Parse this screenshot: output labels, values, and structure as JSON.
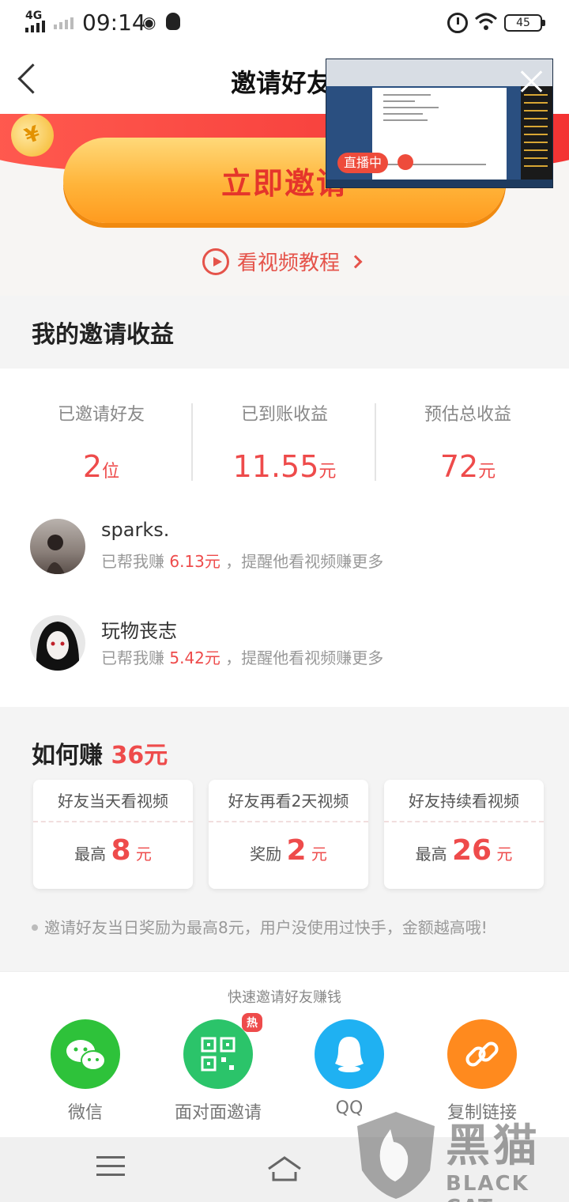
{
  "status_bar": {
    "network": "4G",
    "time": "09:14",
    "battery": "45"
  },
  "header": {
    "title": "邀请好友"
  },
  "banner": {
    "coin_symbol": "¥",
    "invite_button": "立即邀请",
    "video_link": "看视频教程"
  },
  "live_overlay": {
    "badge": "直播中"
  },
  "earnings": {
    "title": "我的邀请收益",
    "stats": [
      {
        "label": "已邀请好友",
        "value": "2",
        "unit": "位"
      },
      {
        "label": "已到账收益",
        "value": "11.55",
        "unit": "元"
      },
      {
        "label": "预估总收益",
        "value": "72",
        "unit": "元"
      }
    ],
    "friends": [
      {
        "name": "sparks.",
        "desc_prefix": "已帮我赚",
        "amount": "6.13元",
        "desc_suffix": "，提醒他看视频赚更多"
      },
      {
        "name": "玩物丧志",
        "desc_prefix": "已帮我赚",
        "amount": "5.42元",
        "desc_suffix": "，提醒他看视频赚更多"
      }
    ]
  },
  "how_to_earn": {
    "title_prefix": "如何赚",
    "title_amount": "36元",
    "tiers": [
      {
        "label": "好友当天看视频",
        "prefix": "最高",
        "amount": "8",
        "unit": "元"
      },
      {
        "label": "好友再看2天视频",
        "prefix": "奖励",
        "amount": "2",
        "unit": "元"
      },
      {
        "label": "好友持续看视频",
        "prefix": "最高",
        "amount": "26",
        "unit": "元"
      }
    ],
    "note": "邀请好友当日奖励为最高8元，用户没使用过快手，金额越高哦!"
  },
  "share": {
    "title": "快速邀请好友赚钱",
    "items": [
      {
        "label": "微信",
        "icon": "wechat-icon",
        "color": "#2ec23a"
      },
      {
        "label": "面对面邀请",
        "icon": "qr-code-icon",
        "color": "#2bc46a",
        "badge": "热"
      },
      {
        "label": "QQ",
        "icon": "qq-icon",
        "color": "#1fb1f2"
      },
      {
        "label": "复制链接",
        "icon": "link-icon",
        "color": "#ff8a1e"
      }
    ]
  },
  "watermark": {
    "text": "黑猫",
    "sub": "BLACK CAT"
  },
  "colors": {
    "accent": "#ee4b4b",
    "banner_red": "#f33232",
    "button_orange": "#ffb43a"
  }
}
